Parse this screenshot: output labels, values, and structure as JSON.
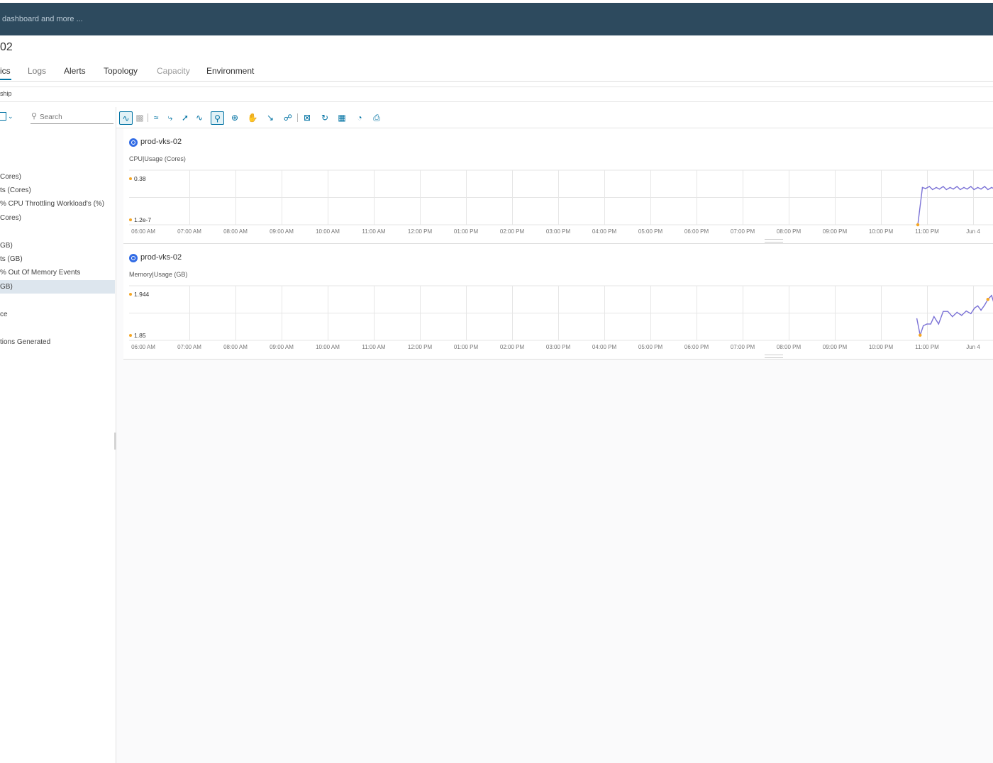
{
  "header": {
    "search_hint": "dashboard and more ..."
  },
  "page": {
    "title": "02"
  },
  "tabs": [
    {
      "label": "ics",
      "state": "active"
    },
    {
      "label": "Logs",
      "state": "partial"
    },
    {
      "label": "Alerts",
      "state": "normal"
    },
    {
      "label": "Topology",
      "state": "normal"
    },
    {
      "label": "Capacity",
      "state": "muted"
    },
    {
      "label": "Environment",
      "state": "normal"
    }
  ],
  "subrow": {
    "label": "ship"
  },
  "left_panel": {
    "search_placeholder": "Search",
    "items": [
      {
        "label": "Cores)",
        "selected": false
      },
      {
        "label": "ts (Cores)",
        "selected": false
      },
      {
        "label": "% CPU Throttling Workload's (%)",
        "selected": false
      },
      {
        "label": "Cores)",
        "selected": false
      },
      {
        "label": "GB)",
        "selected": false
      },
      {
        "label": "ts (GB)",
        "selected": false
      },
      {
        "label": "% Out Of Memory Events",
        "selected": false
      },
      {
        "label": "GB)",
        "selected": true
      },
      {
        "label": "ce",
        "selected": false
      },
      {
        "label": "tions Generated",
        "selected": false
      }
    ]
  },
  "toolbar": {
    "icons": [
      "multi-chart-icon",
      "bar-chart-icon",
      "split-chart-icon",
      "trend-icon",
      "anomaly-icon",
      "line-icon",
      "zoom-icon",
      "zoom-in-icon",
      "pan-icon",
      "collapse-icon",
      "link-icon",
      "close-charts-icon",
      "refresh-icon",
      "calendar-icon",
      "gauge-icon",
      "export-icon"
    ]
  },
  "chart_data": [
    {
      "type": "line",
      "object_name": "prod-vks-02",
      "metric": "CPU|Usage (Cores)",
      "max_label": "0.38",
      "min_label": "1.2e-7",
      "x_ticks": [
        "06:00 AM",
        "07:00 AM",
        "08:00 AM",
        "09:00 AM",
        "10:00 AM",
        "11:00 AM",
        "12:00 PM",
        "01:00 PM",
        "02:00 PM",
        "03:00 PM",
        "04:00 PM",
        "05:00 PM",
        "06:00 PM",
        "07:00 PM",
        "08:00 PM",
        "09:00 PM",
        "10:00 PM",
        "11:00 PM",
        "Jun 4"
      ],
      "ylim": [
        0,
        0.5
      ],
      "series_color": "#7b72d6",
      "points": [
        [
          16.8,
          1e-07
        ],
        [
          16.9,
          0.36
        ],
        [
          16.97,
          0.35
        ],
        [
          17.05,
          0.37
        ],
        [
          17.12,
          0.34
        ],
        [
          17.2,
          0.36
        ],
        [
          17.27,
          0.345
        ],
        [
          17.35,
          0.37
        ],
        [
          17.42,
          0.34
        ],
        [
          17.5,
          0.36
        ],
        [
          17.57,
          0.345
        ],
        [
          17.65,
          0.37
        ],
        [
          17.72,
          0.34
        ],
        [
          17.8,
          0.36
        ],
        [
          17.87,
          0.345
        ],
        [
          17.95,
          0.37
        ],
        [
          18.02,
          0.34
        ],
        [
          18.1,
          0.36
        ],
        [
          18.17,
          0.345
        ],
        [
          18.25,
          0.37
        ],
        [
          18.32,
          0.34
        ],
        [
          18.4,
          0.36
        ],
        [
          18.47,
          0.345
        ],
        [
          18.55,
          0.37
        ],
        [
          18.62,
          0.34
        ],
        [
          18.7,
          0.36
        ]
      ],
      "max_point_x": 16.8,
      "min_point_x": 16.8
    },
    {
      "type": "line",
      "object_name": "prod-vks-02",
      "metric": "Memory|Usage (GB)",
      "max_label": "1.944",
      "min_label": "1.85",
      "x_ticks": [
        "06:00 AM",
        "07:00 AM",
        "08:00 AM",
        "09:00 AM",
        "10:00 AM",
        "11:00 AM",
        "12:00 PM",
        "01:00 PM",
        "02:00 PM",
        "03:00 PM",
        "04:00 PM",
        "05:00 PM",
        "06:00 PM",
        "07:00 PM",
        "08:00 PM",
        "09:00 PM",
        "10:00 PM",
        "11:00 PM",
        "Jun 4"
      ],
      "ylim": [
        1.84,
        1.96
      ],
      "series_color": "#7b72d6",
      "points": [
        [
          16.78,
          1.89
        ],
        [
          16.85,
          1.852
        ],
        [
          16.92,
          1.874
        ],
        [
          17.0,
          1.878
        ],
        [
          17.08,
          1.878
        ],
        [
          17.15,
          1.895
        ],
        [
          17.25,
          1.878
        ],
        [
          17.35,
          1.907
        ],
        [
          17.45,
          1.907
        ],
        [
          17.55,
          1.895
        ],
        [
          17.65,
          1.905
        ],
        [
          17.75,
          1.898
        ],
        [
          17.85,
          1.908
        ],
        [
          17.95,
          1.902
        ],
        [
          18.03,
          1.915
        ],
        [
          18.1,
          1.92
        ],
        [
          18.17,
          1.91
        ],
        [
          18.25,
          1.922
        ],
        [
          18.32,
          1.935
        ],
        [
          18.4,
          1.944
        ],
        [
          18.47,
          1.92
        ],
        [
          18.55,
          1.905
        ],
        [
          18.62,
          1.905
        ],
        [
          18.7,
          1.895
        ]
      ],
      "max_point_x": 18.32,
      "min_point_x": 16.85
    }
  ]
}
